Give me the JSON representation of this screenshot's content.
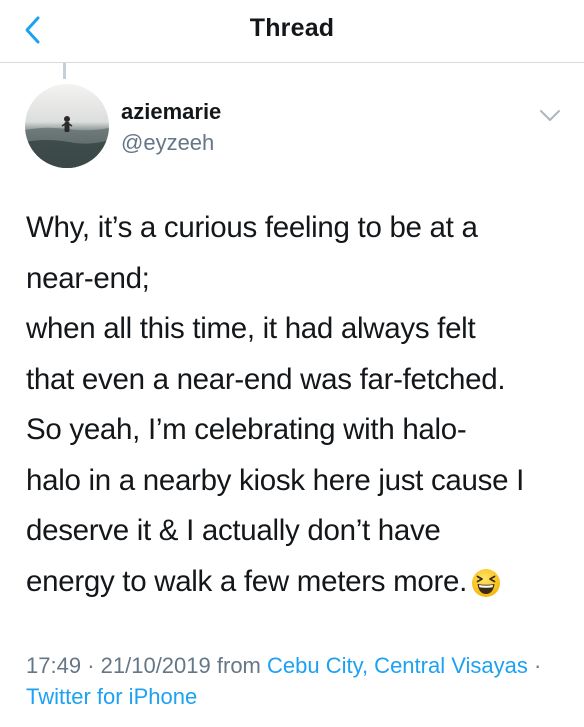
{
  "nav": {
    "title": "Thread"
  },
  "author": {
    "name": "aziemarie",
    "handle": "@eyzeeh"
  },
  "tweet": {
    "text": "Why, it’s a curious feeling to be at a\nnear-end;\nwhen all this time, it had always felt\nthat even a near-end was far-fetched.\nSo yeah, I’m celebrating with halo-\nhalo in a nearby kiosk here just cause I\ndeserve it & I actually don’t have\nenergy to walk a few meters more.",
    "emoji": "grinning-squinting-face-icon"
  },
  "meta": {
    "time": "17:49",
    "date": "21/10/2019",
    "from_label": "from",
    "location": "Cebu City, Central Visayas",
    "separator": "·",
    "client": "Twitter for iPhone"
  },
  "colors": {
    "accent": "#1da1f2",
    "secondary_text": "#657786",
    "text": "#14171a"
  }
}
